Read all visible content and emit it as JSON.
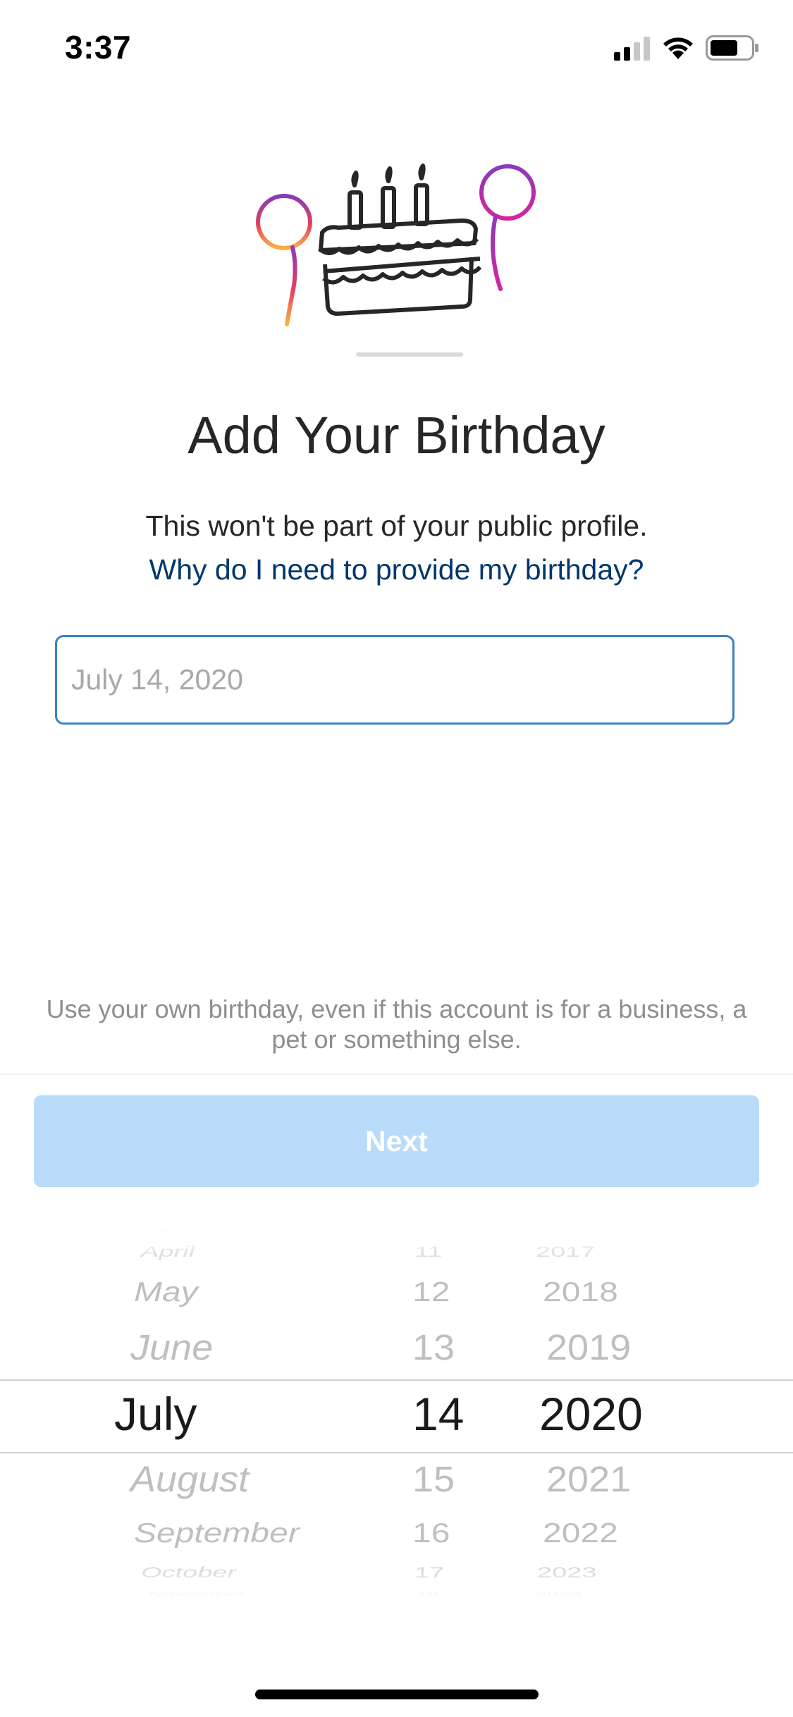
{
  "status_bar": {
    "time": "3:37",
    "icons": [
      "signal-icon",
      "wifi-icon",
      "battery-icon"
    ]
  },
  "illustration": {
    "icon": "birthday-cake-with-balloons-icon",
    "balloon_colors": [
      "#8a3ab9",
      "#e4405f",
      "#fcaf45"
    ]
  },
  "title": "Add Your Birthday",
  "subtitle": "This won't be part of your public profile.",
  "why_link": "Why do I need to provide my birthday?",
  "birthday_input": {
    "placeholder": "July 14, 2020"
  },
  "footnote": "Use your own birthday, even if this account is for a business, a pet or something else.",
  "next_button": {
    "label": "Next",
    "enabled": false
  },
  "date_picker": {
    "selected": {
      "month": "July",
      "day": "14",
      "year": "2020"
    },
    "months": [
      "March",
      "April",
      "May",
      "June",
      "July",
      "August",
      "September",
      "October",
      "November"
    ],
    "days": [
      "10",
      "11",
      "12",
      "13",
      "14",
      "15",
      "16",
      "17",
      "18"
    ],
    "years": [
      "2016",
      "2017",
      "2018",
      "2019",
      "2020",
      "2021",
      "2022",
      "2023",
      "2024"
    ]
  },
  "colors": {
    "link": "#00376b",
    "input_border": "#3b82c4",
    "button_disabled": "#b9dbfa",
    "muted_text": "#8e8e8e"
  }
}
